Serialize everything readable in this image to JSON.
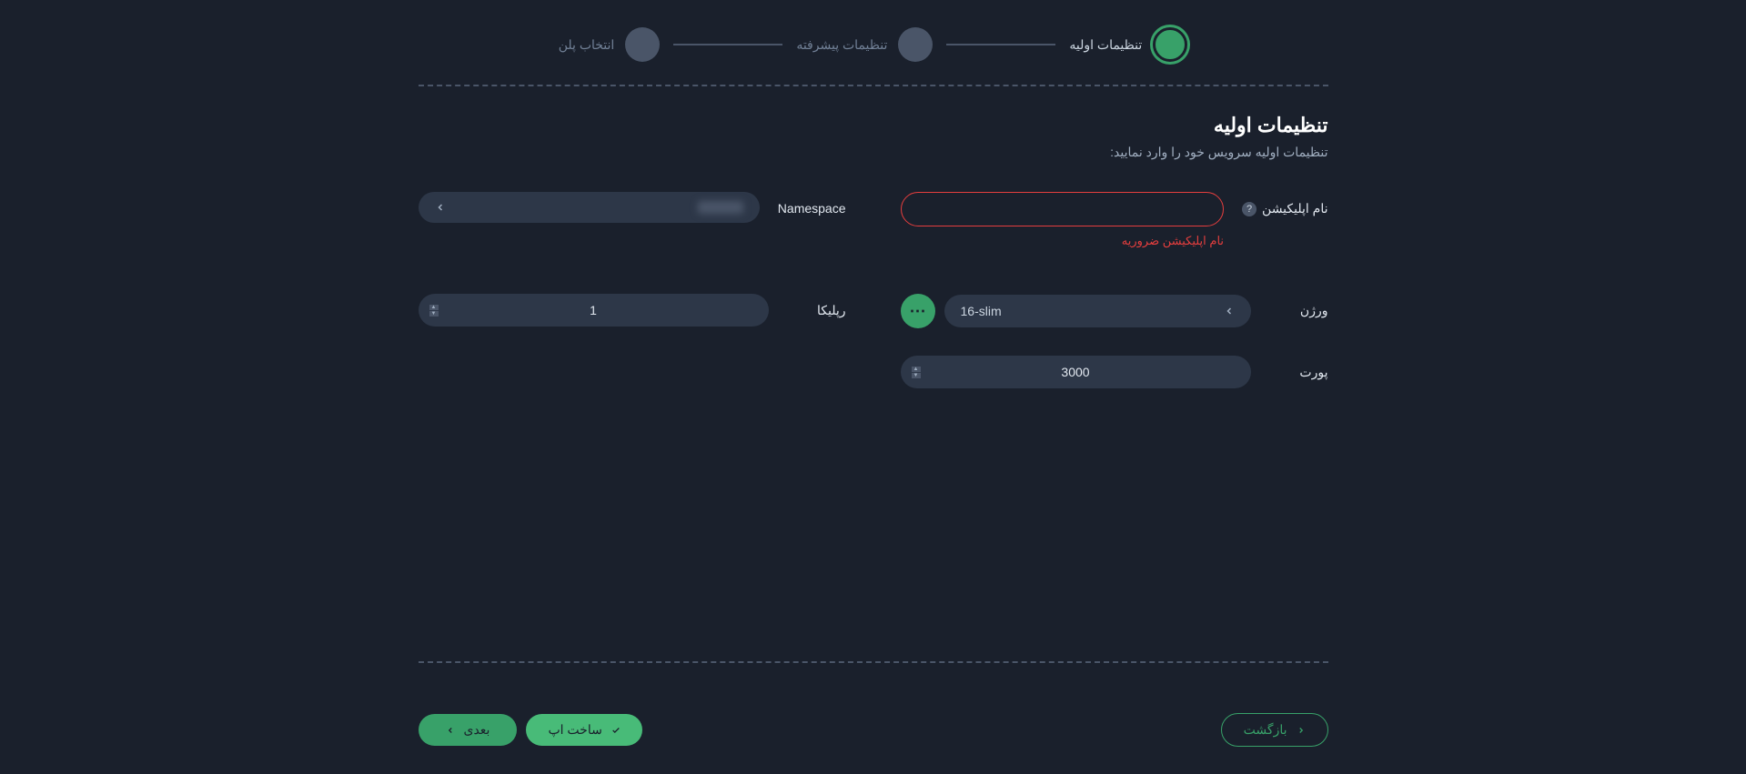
{
  "stepper": {
    "steps": [
      {
        "label": "تنظیمات اولیه",
        "active": true
      },
      {
        "label": "تنظیمات پیشرفته",
        "active": false
      },
      {
        "label": "انتخاب پلن",
        "active": false
      }
    ]
  },
  "section": {
    "title": "تنظیمات اولیه",
    "subtitle": "تنظیمات اولیه سرویس خود را وارد نمایید:"
  },
  "form": {
    "appName": {
      "label": "نام اپلیکیشن",
      "value": "",
      "error": "نام اپلیکیشن ضروریه"
    },
    "namespace": {
      "label": "Namespace",
      "placeholder": "namespace"
    },
    "version": {
      "label": "ورژن",
      "value": "16-slim"
    },
    "replica": {
      "label": "رپلیکا",
      "value": "1"
    },
    "port": {
      "label": "پورت",
      "value": "3000"
    }
  },
  "footer": {
    "back": "بازگشت",
    "create": "ساخت اپ",
    "next": "بعدی"
  }
}
